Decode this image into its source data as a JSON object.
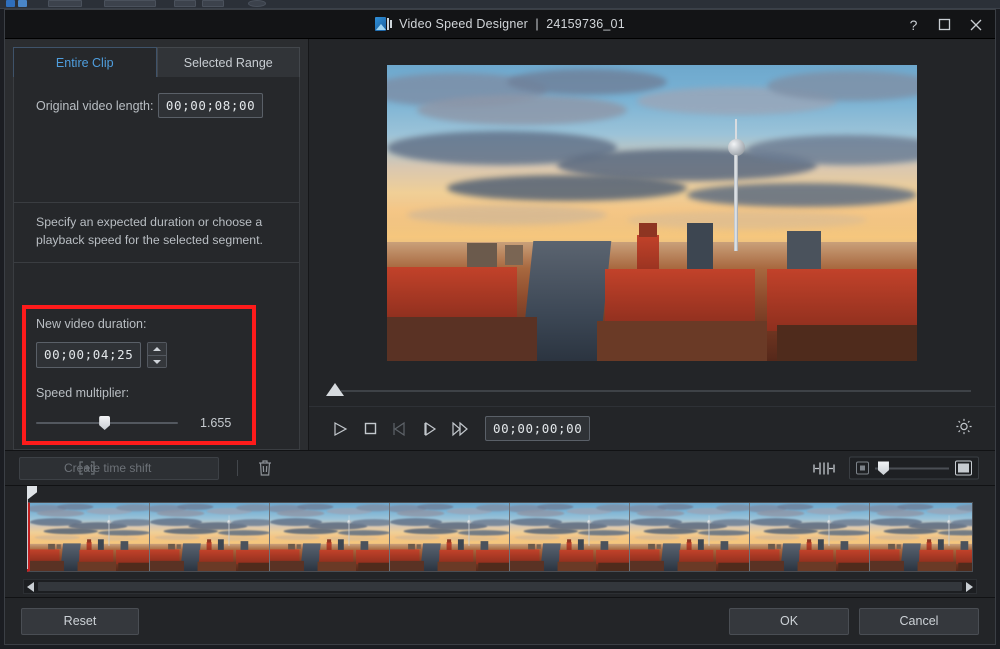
{
  "window": {
    "title": "Video Speed Designer",
    "separator": "|",
    "clip_name": "24159736_01",
    "app_icon": "video-speed-designer-icon",
    "controls": {
      "help": "?",
      "help_icon": "help-question-icon",
      "maximize_icon": "maximize-icon",
      "close_icon": "close-icon"
    }
  },
  "left_panel": {
    "tabs": [
      {
        "label": "Entire Clip",
        "active": true
      },
      {
        "label": "Selected Range",
        "active": false
      }
    ],
    "original_length_label": "Original video length:",
    "original_length_value": "00;00;08;00",
    "description": "Specify an expected duration or choose a playback speed for the selected segment.",
    "new_duration_label": "New video duration:",
    "new_duration_value": "00;00;04;25",
    "spinner_up_icon": "spinner-up-arrow-icon",
    "spinner_down_icon": "spinner-down-arrow-icon",
    "speed_label": "Speed multiplier:",
    "speed_value": "1.655",
    "speed_slider_percent": 48,
    "highlight_color": "#fe1b1b",
    "accent_color": "#4f9ede"
  },
  "preview": {
    "image_description": "Berlin cityscape at sunset with Fernsehturm TV tower and Spree river",
    "scrub_position_percent": 0
  },
  "transport": {
    "buttons": [
      {
        "name": "play-button",
        "icon": "play-icon",
        "enabled": true
      },
      {
        "name": "stop-button",
        "icon": "stop-square-icon",
        "enabled": true
      },
      {
        "name": "previous-frame-button",
        "icon": "previous-frame-icon",
        "enabled": false
      },
      {
        "name": "next-frame-button",
        "icon": "next-frame-icon",
        "enabled": true
      },
      {
        "name": "fast-forward-button",
        "icon": "fast-forward-icon",
        "enabled": true
      }
    ],
    "timecode": "00;00;00;00",
    "settings_icon": "gear-icon"
  },
  "timeline": {
    "create_time_shift_label": "Create time shift",
    "create_time_shift_icon": "add-bracket-plus-icon",
    "delete_icon": "trash-icon",
    "fit_icon": "fit-to-window-icon",
    "zoom_out_icon": "small-square-icon",
    "zoom_in_icon": "large-square-icon",
    "zoom_slider_percent": 4,
    "frame_count": 8,
    "scroll_left_icon": "scroll-left-arrow-icon",
    "scroll_right_icon": "scroll-right-arrow-icon"
  },
  "footer": {
    "reset_label": "Reset",
    "ok_label": "OK",
    "cancel_label": "Cancel"
  }
}
